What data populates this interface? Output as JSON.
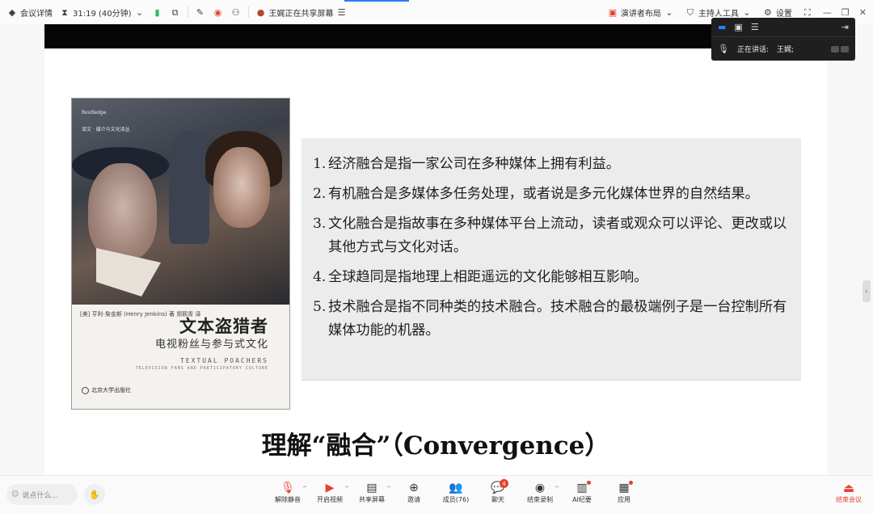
{
  "topbar": {
    "meeting_info_label": "会议详情",
    "timer": "31:19 (40分钟)",
    "sharing_status": "王娓正在共享屏幕",
    "presenter_layout_label": "演讲者布局",
    "host_tools_label": "主持人工具",
    "settings_label": "设置"
  },
  "speaker_overlay": {
    "speaking_label": "正在讲话:",
    "speaker_name": "王娓;"
  },
  "book": {
    "publisher": "Routledge",
    "series": "译文 · 媒介与文化译丛",
    "author_line": "[美] 亨利·詹金斯 (Henry Jenkins) 著    郑熙青 译",
    "title": "文本盗猎者",
    "subtitle": "电视粉丝与参与式文化",
    "english_title": "TEXTUAL POACHERS",
    "english_subtitle": "TELEVISION FANS AND PARTICIPATORY CULTURE",
    "press": "北京大学出版社"
  },
  "slide": {
    "points": [
      {
        "num": "1.",
        "text": "经济融合是指一家公司在多种媒体上拥有利益。"
      },
      {
        "num": "2.",
        "text": "有机融合是多媒体多任务处理，或者说是多元化媒体世界的自然结果。"
      },
      {
        "num": "3.",
        "text": "文化融合是指故事在多种媒体平台上流动，读者或观众可以评论、更改或以其他方式与文化对话。"
      },
      {
        "num": "4.",
        "text": "全球趋同是指地理上相距遥远的文化能够相互影响。"
      },
      {
        "num": "5.",
        "text": "技术融合是指不同种类的技术融合。技术融合的最极端例子是一台控制所有媒体功能的机器。"
      }
    ],
    "heading": "理解“融合”（Convergence）"
  },
  "annotate_label": "批注",
  "bottombar": {
    "chat_placeholder": "说点什么...",
    "tools": [
      {
        "label": "解除静音",
        "icon": "mic-muted-icon"
      },
      {
        "label": "开启视频",
        "icon": "camera-off-icon"
      },
      {
        "label": "共享屏幕",
        "icon": "share-screen-icon"
      },
      {
        "label": "邀请",
        "icon": "invite-icon"
      },
      {
        "label": "成员(76)",
        "icon": "members-icon"
      },
      {
        "label": "聊天",
        "icon": "chat-icon",
        "badge": "4"
      },
      {
        "label": "结束录制",
        "icon": "record-icon"
      },
      {
        "label": "AI纪要",
        "icon": "ai-notes-icon"
      },
      {
        "label": "应用",
        "icon": "apps-icon"
      }
    ],
    "end_label": "结束会议"
  },
  "colors": {
    "accent": "#2b7cf6",
    "danger": "#e5412d"
  }
}
